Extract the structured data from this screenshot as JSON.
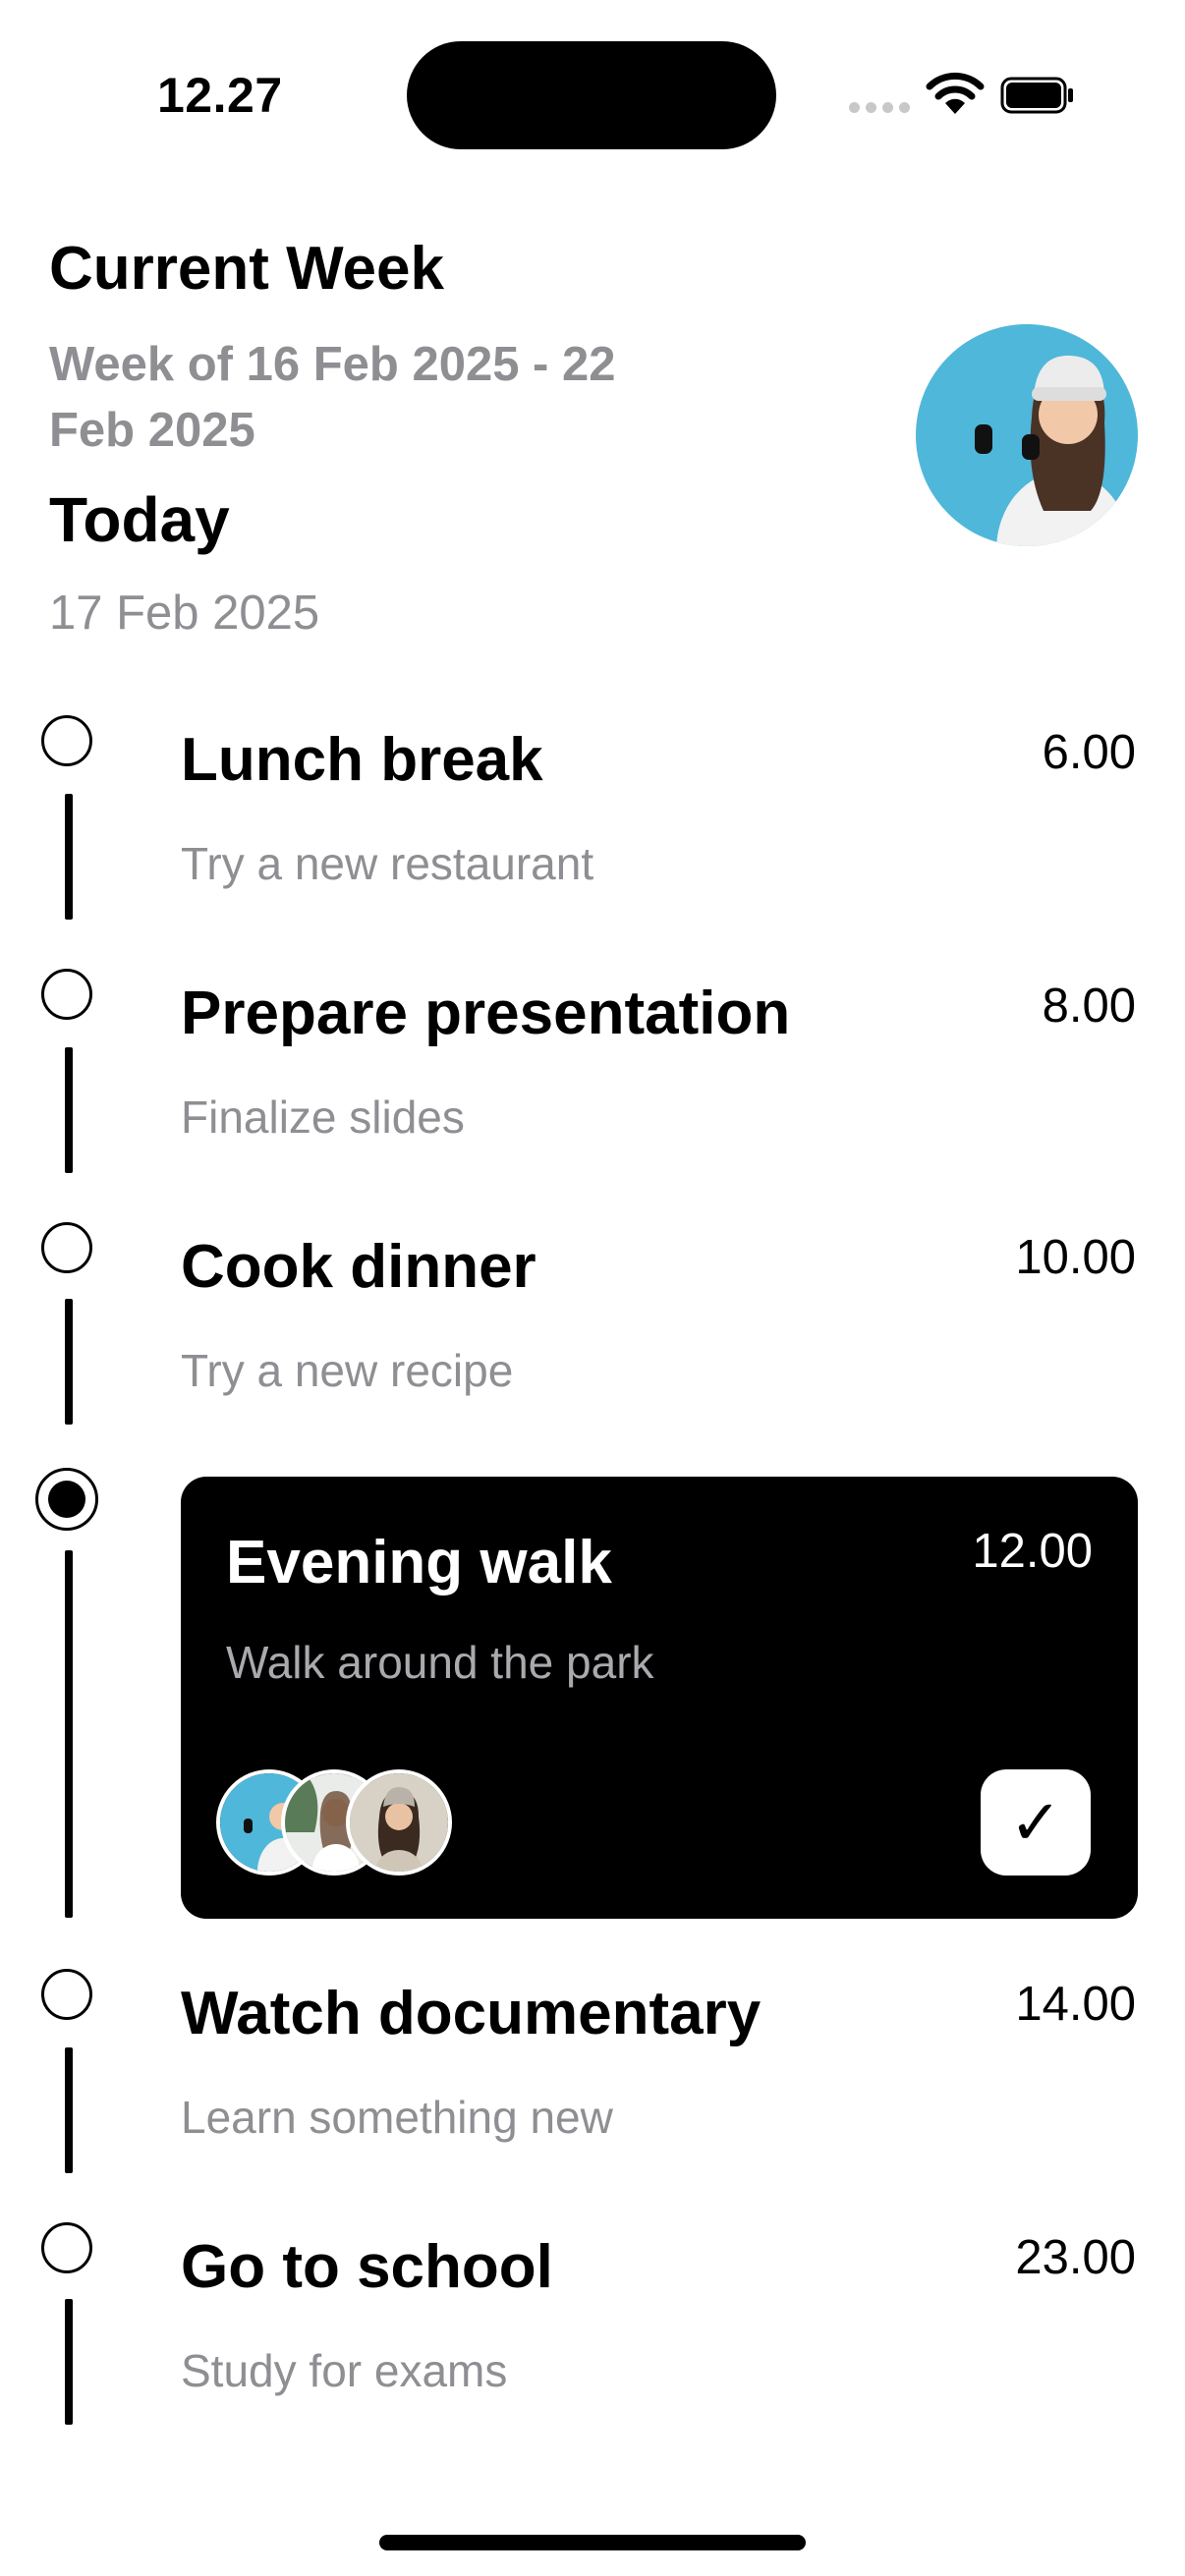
{
  "status_bar": {
    "time": "12.27"
  },
  "header": {
    "week_title": "Current Week",
    "week_range": "Week of 16 Feb 2025 - 22 Feb 2025",
    "today_title": "Today",
    "today_date": "17 Feb 2025"
  },
  "tasks": [
    {
      "title": "Lunch break",
      "subtitle": "Try a new restaurant",
      "time": "6.00"
    },
    {
      "title": "Prepare presentation",
      "subtitle": "Finalize slides",
      "time": "8.00"
    },
    {
      "title": "Cook dinner",
      "subtitle": "Try a new recipe",
      "time": "10.00"
    },
    {
      "title": "Evening walk",
      "subtitle": "Walk around the park",
      "time": "12.00",
      "active": true
    },
    {
      "title": "Watch documentary",
      "subtitle": "Learn something new",
      "time": "14.00"
    },
    {
      "title": "Go to school",
      "subtitle": "Study for exams",
      "time": "23.00"
    }
  ],
  "icons": {
    "check": "✓",
    "status": [
      "signal-icon",
      "wifi-icon",
      "battery-icon"
    ]
  },
  "colors": {
    "accent_card": "#000000",
    "secondary_text": "#8e8e93",
    "avatar_bg": "#4fb7da"
  }
}
